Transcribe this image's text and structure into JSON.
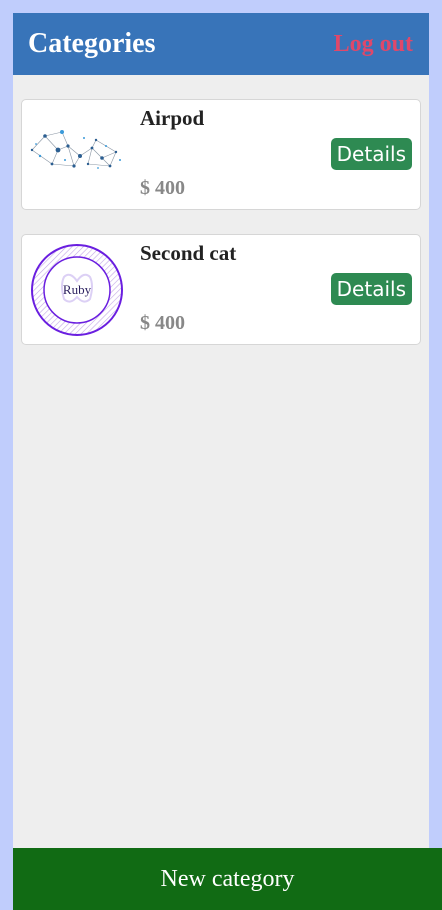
{
  "header": {
    "title": "Categories",
    "logout_label": "Log out"
  },
  "categories": [
    {
      "name": "Airpod",
      "price": "$ 400",
      "details_label": "Details",
      "image_icon": "network-graph-image"
    },
    {
      "name": "Second cat",
      "price": "$ 400",
      "details_label": "Details",
      "image_icon": "ruby-logo-image",
      "image_text": "Ruby"
    }
  ],
  "footer": {
    "new_category_label": "New category"
  },
  "colors": {
    "page_background": "#c0cdfc",
    "header": "#3874b9",
    "logout": "#e0486a",
    "details_button": "#2e8a52",
    "footer": "#116b14"
  }
}
